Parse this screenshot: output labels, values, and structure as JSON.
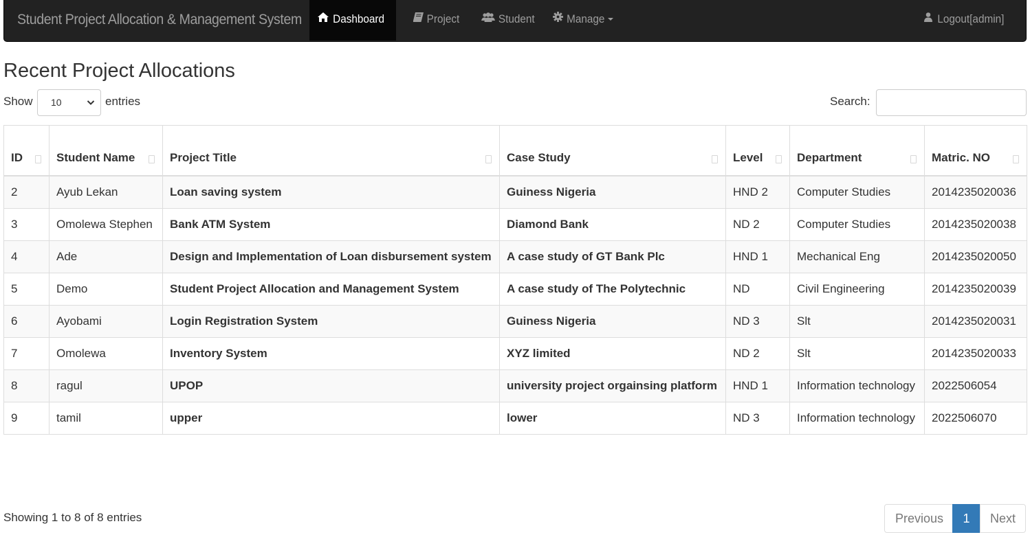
{
  "navbar": {
    "brand": "Student Project Allocation & Management System",
    "items": [
      {
        "label": "Dashboard",
        "icon": "home-icon"
      },
      {
        "label": "Project",
        "icon": "book-icon"
      },
      {
        "label": "Student",
        "icon": "users-icon"
      },
      {
        "label": "Manage",
        "icon": "gear-icon"
      }
    ],
    "logout": "Logout[admin]"
  },
  "page": {
    "title": "Recent Project Allocations",
    "show_label": "Show",
    "entries_value": "10",
    "entries_label": "entries",
    "search_label": "Search:",
    "search_value": ""
  },
  "table": {
    "headers": {
      "id": "ID",
      "student_name": "Student Name",
      "project_title": "Project Title",
      "case_study": "Case Study",
      "level": "Level",
      "department": "Department",
      "matric": "Matric. NO"
    },
    "rows": [
      {
        "id": "2",
        "name": "Ayub Lekan",
        "title": "Loan saving system",
        "case": "Guiness Nigeria",
        "level": "HND 2",
        "dept": "Computer Studies",
        "matric": "2014235020036"
      },
      {
        "id": "3",
        "name": "Omolewa Stephen",
        "title": "Bank ATM System",
        "case": "Diamond Bank",
        "level": "ND 2",
        "dept": "Computer Studies",
        "matric": "2014235020038"
      },
      {
        "id": "4",
        "name": "Ade",
        "title": "Design and Implementation of Loan disbursement system",
        "case": "A case study of GT Bank Plc",
        "level": "HND 1",
        "dept": "Mechanical Eng",
        "matric": "2014235020050"
      },
      {
        "id": "5",
        "name": "Demo",
        "title": "Student Project Allocation and Management System",
        "case": "A case study of The Polytechnic",
        "level": "ND",
        "dept": "Civil Engineering",
        "matric": "2014235020039"
      },
      {
        "id": "6",
        "name": "Ayobami",
        "title": "Login Registration System",
        "case": "Guiness Nigeria",
        "level": "ND 3",
        "dept": "Slt",
        "matric": "2014235020031"
      },
      {
        "id": "7",
        "name": "Omolewa",
        "title": "Inventory System",
        "case": "XYZ limited",
        "level": "ND 2",
        "dept": "Slt",
        "matric": "2014235020033"
      },
      {
        "id": "8",
        "name": "ragul",
        "title": "UPOP",
        "case": "university project orgainsing platform",
        "level": "HND 1",
        "dept": "Information technology",
        "matric": "2022506054"
      },
      {
        "id": "9",
        "name": "tamil",
        "title": "upper",
        "case": "lower",
        "level": "ND 3",
        "dept": "Information technology",
        "matric": "2022506070"
      }
    ]
  },
  "footer": {
    "info": "Showing 1 to 8 of 8 entries",
    "previous": "Previous",
    "current_page": "1",
    "next": "Next"
  },
  "colors": {
    "navbar_bg": "#222222",
    "active_bg": "#080808",
    "accent": "#337ab7"
  }
}
